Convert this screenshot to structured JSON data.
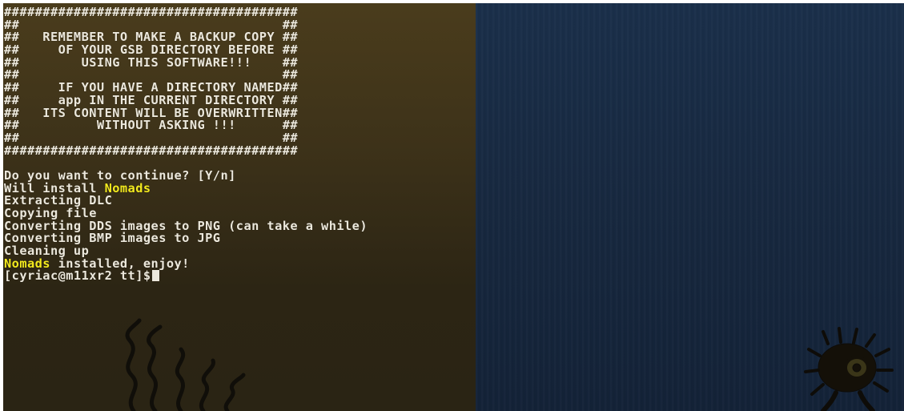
{
  "banner": {
    "lines": [
      "######################################",
      "##                                  ##",
      "##   REMEMBER TO MAKE A BACKUP COPY ##",
      "##     OF YOUR GSB DIRECTORY BEFORE ##",
      "##        USING THIS SOFTWARE!!!    ##",
      "##                                  ##",
      "##     IF YOU HAVE A DIRECTORY NAMED##",
      "##     app IN THE CURRENT DIRECTORY ##",
      "##   ITS CONTENT WILL BE OVERWRITTEN##",
      "##          WITHOUT ASKING !!!      ##",
      "##                                  ##",
      "######################################"
    ]
  },
  "output": {
    "prompt_continue": "Do you want to continue? [Y/n]",
    "will_install_prefix": "Will install ",
    "dlc_name": "Nomads",
    "steps": [
      "Extracting DLC",
      "Copying file",
      "Converting DDS images to PNG (can take a while)",
      "Converting BMP images to JPG",
      "Cleaning up"
    ],
    "installed_suffix": " installed, enjoy!",
    "shell_prompt": "[cyriac@m11xr2 tt]$"
  },
  "colors": {
    "text": "#ece8dc",
    "highlight": "#f3ea1e",
    "background_left": "#3d3219",
    "background_right": "#17283f"
  }
}
